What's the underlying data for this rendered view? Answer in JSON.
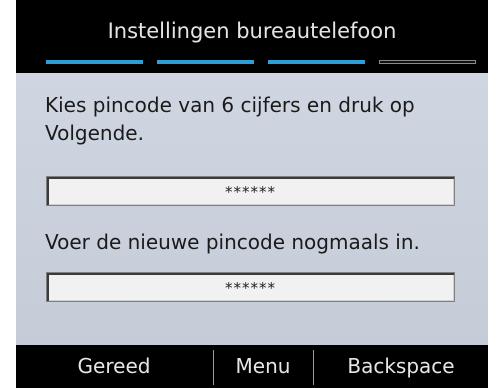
{
  "header": {
    "title": "Instellingen bureautelefoon",
    "steps_total": 4,
    "steps_completed": 3,
    "accent_color": "#2e9fd6"
  },
  "form": {
    "prompt_new_pin": "Kies pincode van 6 cijfers en druk op Volgende.",
    "new_pin_value": "******",
    "prompt_confirm_pin": "Voer de nieuwe pincode nogmaals in.",
    "confirm_pin_value": "******"
  },
  "softkeys": {
    "left": "Gereed",
    "center": "Menu",
    "right": "Backspace"
  }
}
